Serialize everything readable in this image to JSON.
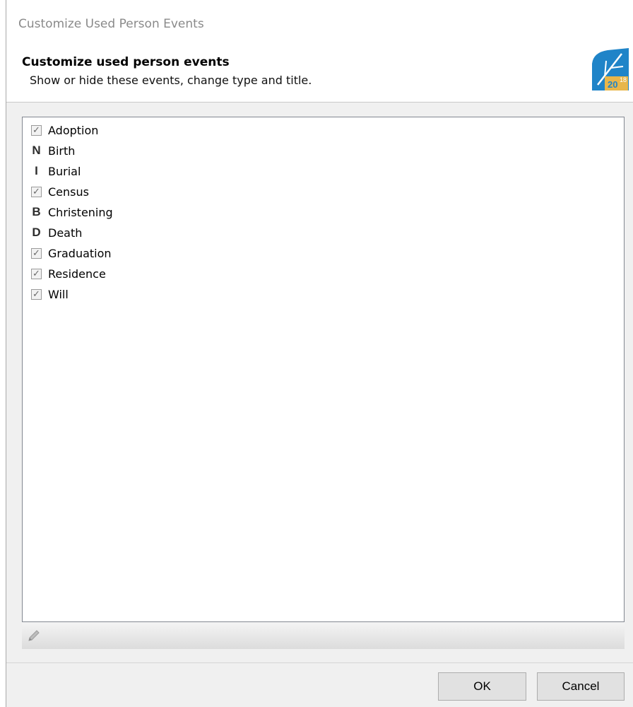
{
  "window": {
    "title": "Customize Used Person Events"
  },
  "header": {
    "title": "Customize used person events",
    "description": "Show or hide these events, change type and title.",
    "logo_icon": "app-logo-leaf-icon",
    "logo_text_main": "20",
    "logo_text_sup": "18"
  },
  "events": [
    {
      "label": "Adoption",
      "marker": "checkbox",
      "checked": true
    },
    {
      "label": "Birth",
      "marker": "letter",
      "letter": "N"
    },
    {
      "label": "Burial",
      "marker": "letter",
      "letter": "I"
    },
    {
      "label": "Census",
      "marker": "checkbox",
      "checked": true
    },
    {
      "label": "Christening",
      "marker": "letter",
      "letter": "B"
    },
    {
      "label": "Death",
      "marker": "letter",
      "letter": "D"
    },
    {
      "label": "Graduation",
      "marker": "checkbox",
      "checked": true
    },
    {
      "label": "Residence",
      "marker": "checkbox",
      "checked": true
    },
    {
      "label": "Will",
      "marker": "checkbox",
      "checked": true
    }
  ],
  "toolbar": {
    "edit_icon": "pencil-icon"
  },
  "buttons": {
    "ok": "OK",
    "cancel": "Cancel"
  },
  "colors": {
    "logo_blue": "#1f84c8",
    "logo_gold": "#e8b64a"
  }
}
